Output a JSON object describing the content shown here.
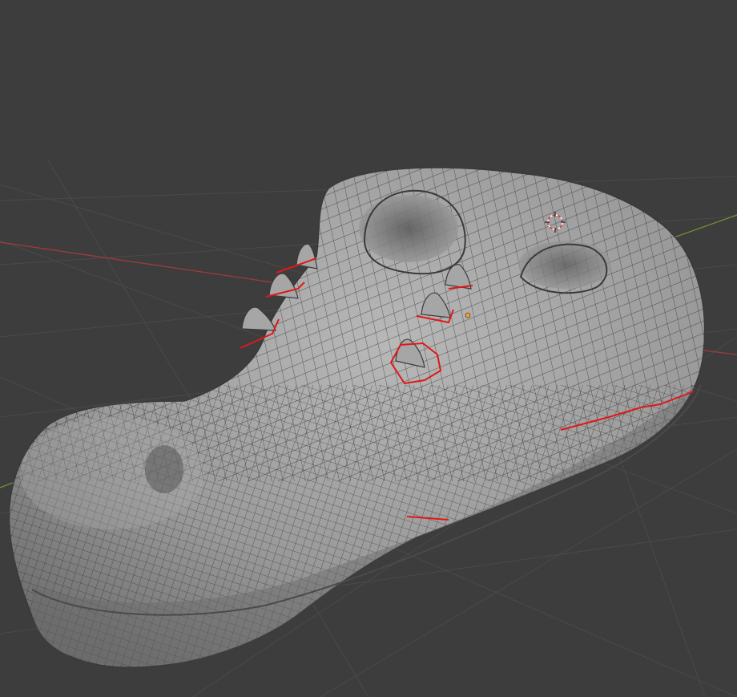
{
  "viewport": {
    "background": "#3d3d3d",
    "grid_color": "#4a4a4a",
    "x_axis_color": "#b03a3a",
    "y_axis_color": "#7a9a3a",
    "mesh_fill": "#9c9c9c",
    "wire_color": "#2a2a2a",
    "seam_color": "#e01818",
    "origin_color": "#f0a030"
  },
  "scene": {
    "object": "crocodile-head-mesh",
    "display": "solid-wireframe",
    "seams": "marked"
  }
}
